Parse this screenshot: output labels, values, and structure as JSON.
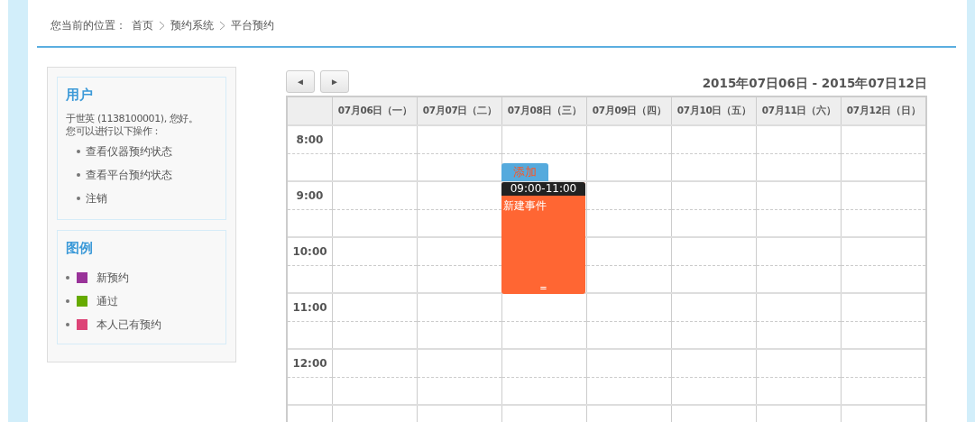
{
  "breadcrumb": {
    "label": "您当前的位置：",
    "items": [
      "首页",
      "预约系统",
      "平台预约"
    ]
  },
  "user_panel": {
    "title": "用户",
    "greeting": "于世英 (1138100001), 您好。",
    "prompt": "您可以进行以下操作：",
    "actions": [
      "查看仪器预约状态",
      "查看平台预约状态",
      "注销"
    ]
  },
  "legend": {
    "title": "图例",
    "items": [
      {
        "label": "新预约",
        "color": "#993399"
      },
      {
        "label": "通过",
        "color": "#66aa00"
      },
      {
        "label": "本人已有预约",
        "color": "#dd4477"
      }
    ]
  },
  "calendar": {
    "prev_button": "◄",
    "next_button": "►",
    "range": "2015年07日06日 - 2015年07日12日",
    "days": [
      "07月06日（一）",
      "07月07日（二）",
      "07月08日（三）",
      "07月09日（四）",
      "07月10日（五）",
      "07月11日（六）",
      "07月12日（日）"
    ],
    "hours": [
      "8:00",
      "9:00",
      "10:00",
      "11:00",
      "12:00"
    ],
    "events": [
      {
        "time": "09:00-11:00",
        "title": "新建事件",
        "handle": "=",
        "add_button": "添加",
        "color": "#ff6633"
      }
    ]
  }
}
